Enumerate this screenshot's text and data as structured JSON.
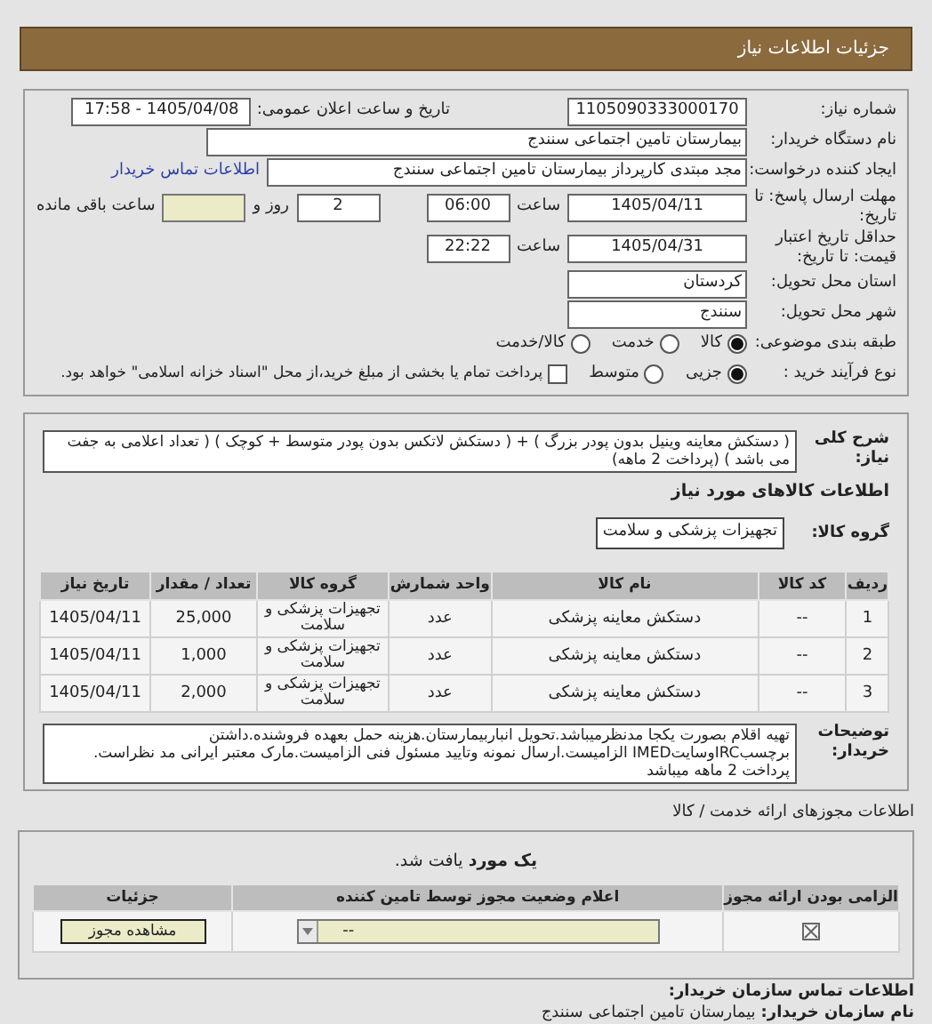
{
  "header": {
    "title": "جزئیات اطلاعات نیاز"
  },
  "details": {
    "need_number": {
      "label": "شماره نیاز:",
      "value": "1105090333000170"
    },
    "announce": {
      "label": "تاریخ و ساعت اعلان عمومی:",
      "value": "1405/04/08 - 17:58"
    },
    "buyer": {
      "label": "نام دستگاه خریدار:",
      "value": "بیمارستان تامین اجتماعی سنندج"
    },
    "requester": {
      "label": "ایجاد کننده درخواست:",
      "value": "مجد مبتدی کارپرداز بیمارستان تامین اجتماعی سنندج",
      "link": "اطلاعات تماس خریدار"
    },
    "deadline": {
      "label": "مهلت ارسال پاسخ: تا تاریخ:",
      "date": "1405/04/11",
      "time_label": "ساعت",
      "time": "06:00",
      "days": "2",
      "days_label": "روز و",
      "remaining_label": "ساعت باقی مانده"
    },
    "validity": {
      "label": "حداقل تاریخ اعتبار قیمت: تا تاریخ:",
      "date": "1405/04/31",
      "time_label": "ساعت",
      "time": "22:22"
    },
    "province": {
      "label": "استان محل تحویل:",
      "value": "کردستان"
    },
    "city": {
      "label": "شهر محل تحویل:",
      "value": "سنندج"
    },
    "category": {
      "label": "طبقه بندی موضوعی:",
      "options": [
        {
          "label": "کالا",
          "selected": true
        },
        {
          "label": "خدمت",
          "selected": false
        },
        {
          "label": "کالا/خدمت",
          "selected": false
        }
      ]
    },
    "process": {
      "label": "نوع فرآیند خرید :",
      "options": [
        {
          "label": "جزیی",
          "selected": true
        },
        {
          "label": "متوسط",
          "selected": false
        }
      ],
      "payment": {
        "checked": false,
        "text": "پرداخت تمام یا بخشی از مبلغ خرید،از محل \"اسناد خزانه اسلامی\" خواهد بود."
      }
    }
  },
  "needs": {
    "description": {
      "label": "شرح کلی نیاز:",
      "text": "( دستکش معاینه وینیل بدون پودر بزرگ ) + ( دستکش لاتکس بدون پودر متوسط + کوچک ) ( تعداد اعلامی به جفت می باشد ) (پرداخت 2 ماهه)"
    },
    "heading": "اطلاعات کالاهای مورد نیاز",
    "group": {
      "label": "گروه کالا:",
      "value": "تجهیزات پزشکی و سلامت"
    },
    "table": {
      "columns": [
        "ردیف",
        "کد کالا",
        "نام کالا",
        "واحد شمارش",
        "گروه کالا",
        "تعداد / مقدار",
        "تاریخ نیاز"
      ],
      "rows": [
        [
          "1",
          "--",
          "دستکش معاینه پزشکی",
          "عدد",
          "تجهیزات پزشکی و سلامت",
          "25,000",
          "1405/04/11"
        ],
        [
          "2",
          "--",
          "دستکش معاینه پزشکی",
          "عدد",
          "تجهیزات پزشکی و سلامت",
          "1,000",
          "1405/04/11"
        ],
        [
          "3",
          "--",
          "دستکش معاینه پزشکی",
          "عدد",
          "تجهیزات پزشکی و سلامت",
          "2,000",
          "1405/04/11"
        ]
      ]
    },
    "notes": {
      "label": "توضیحات خریدار:",
      "text": "تهیه اقلام بصورت یکجا مدنظرمیباشد.تحویل انباربیمارستان.هزینه حمل بعهده فروشنده.داشتن برچسبIRCوسایتIMED الزامیست.ارسال نمونه وتایید مسئول فنی الزامیست.مارک معتبر ایرانی مد نظراست. پرداخت 2 ماهه میباشد"
    }
  },
  "licenses": {
    "title": "اطلاعات مجوزهای ارائه خدمت / کالا",
    "summary": "**یک مورد** یافت شد.",
    "columns": [
      "الزامی بودن ارائه مجوز",
      "اعلام وضعیت مجوز توسط تامین کننده",
      "جزئیات"
    ],
    "rows": [
      {
        "required": true,
        "status": "--",
        "button": "مشاهده مجوز"
      }
    ]
  },
  "contact": {
    "title": "اطلاعات تماس سازمان خریدار:",
    "org_label": "نام سازمان خریدار:",
    "org_value": "بیمارستان تامین اجتماعی سنندج"
  }
}
